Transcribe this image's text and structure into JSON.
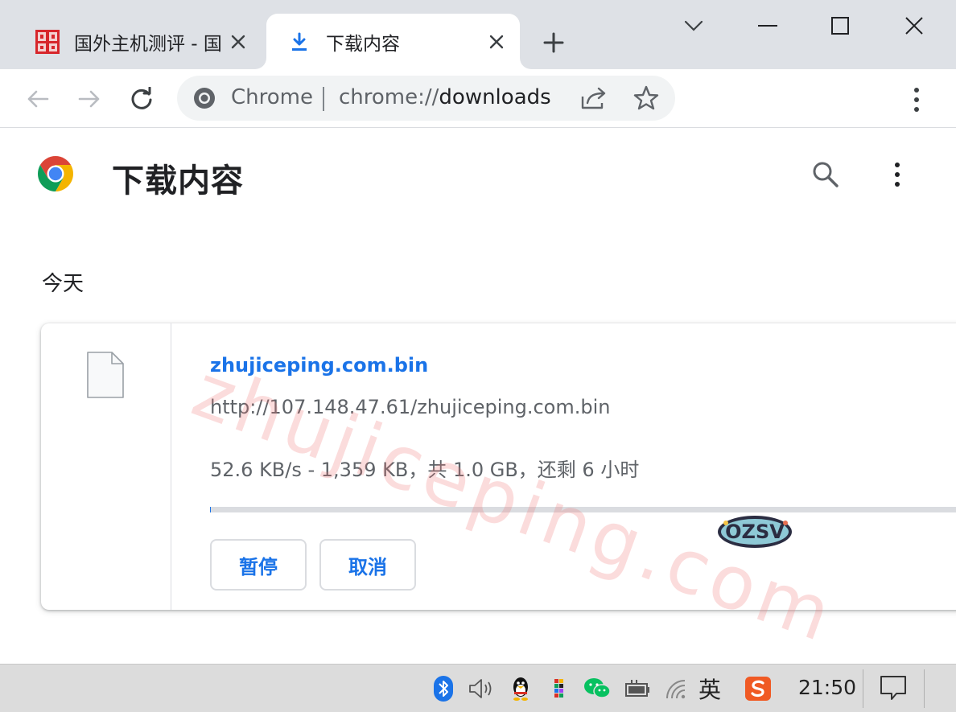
{
  "tabs": [
    {
      "title": "国外主机测评 - 国"
    },
    {
      "title": "下载内容"
    }
  ],
  "omnibox": {
    "site_label": "Chrome",
    "url_prefix": "chrome://",
    "url_host": "downloads"
  },
  "page": {
    "title": "下载内容",
    "date_header": "今天"
  },
  "download": {
    "file_name": "zhujiceping.com.bin",
    "url": "http://107.148.47.61/zhujiceping.com.bin",
    "status": "52.6 KB/s - 1,359 KB，共 1.0 GB，还剩 6 小时",
    "progress": 0.0013,
    "pause_label": "暂停",
    "cancel_label": "取消"
  },
  "watermark": "zhujiceping.com",
  "sticker_text": "OZSV",
  "taskbar": {
    "ime": "英",
    "clock": "21:50"
  },
  "colors": {
    "accent": "#1a73e8",
    "tabstrip": "#dee1e6",
    "omnibox": "#f1f3f4",
    "watermark": "#f07878",
    "taskbar": "#dcdcdc"
  }
}
